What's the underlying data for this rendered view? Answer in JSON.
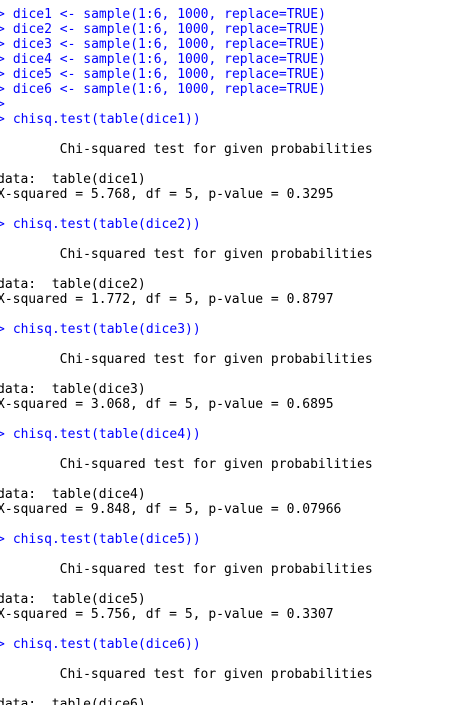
{
  "console": {
    "prompt": ">",
    "lines": [
      {
        "kind": "cmd",
        "text": "dice1 <- sample(1:6, 1000, replace=TRUE)"
      },
      {
        "kind": "cmd",
        "text": "dice2 <- sample(1:6, 1000, replace=TRUE)"
      },
      {
        "kind": "cmd",
        "text": "dice3 <- sample(1:6, 1000, replace=TRUE)"
      },
      {
        "kind": "cmd",
        "text": "dice4 <- sample(1:6, 1000, replace=TRUE)"
      },
      {
        "kind": "cmd",
        "text": "dice5 <- sample(1:6, 1000, replace=TRUE)"
      },
      {
        "kind": "cmd",
        "text": "dice6 <- sample(1:6, 1000, replace=TRUE)"
      },
      {
        "kind": "cmd",
        "text": ""
      },
      {
        "kind": "cmd",
        "text": "chisq.test(table(dice1))"
      },
      {
        "kind": "out",
        "text": "        Chi-squared test for given probabilities"
      },
      {
        "kind": "out",
        "text": "data:  table(dice1)"
      },
      {
        "kind": "out",
        "text": "X-squared = 5.768, df = 5, p-value = 0.3295"
      },
      {
        "kind": "cmd",
        "text": "chisq.test(table(dice2))"
      },
      {
        "kind": "out",
        "text": "        Chi-squared test for given probabilities"
      },
      {
        "kind": "out",
        "text": "data:  table(dice2)"
      },
      {
        "kind": "out",
        "text": "X-squared = 1.772, df = 5, p-value = 0.8797"
      },
      {
        "kind": "cmd",
        "text": "chisq.test(table(dice3))"
      },
      {
        "kind": "out",
        "text": "        Chi-squared test for given probabilities"
      },
      {
        "kind": "out",
        "text": "data:  table(dice3)"
      },
      {
        "kind": "out",
        "text": "X-squared = 3.068, df = 5, p-value = 0.6895"
      },
      {
        "kind": "cmd",
        "text": "chisq.test(table(dice4))"
      },
      {
        "kind": "out",
        "text": "        Chi-squared test for given probabilities"
      },
      {
        "kind": "out",
        "text": "data:  table(dice4)"
      },
      {
        "kind": "out",
        "text": "X-squared = 9.848, df = 5, p-value = 0.07966"
      },
      {
        "kind": "cmd",
        "text": "chisq.test(table(dice5))"
      },
      {
        "kind": "out",
        "text": "        Chi-squared test for given probabilities"
      },
      {
        "kind": "out",
        "text": "data:  table(dice5)"
      },
      {
        "kind": "out",
        "text": "X-squared = 5.756, df = 5, p-value = 0.3307"
      },
      {
        "kind": "cmd",
        "text": "chisq.test(table(dice6))"
      },
      {
        "kind": "out",
        "text": "        Chi-squared test for given probabilities"
      },
      {
        "kind": "out",
        "text": "data:  table(dice6)"
      }
    ]
  },
  "colors": {
    "command": "#0000ff",
    "output": "#000000",
    "background": "#ffffff"
  }
}
